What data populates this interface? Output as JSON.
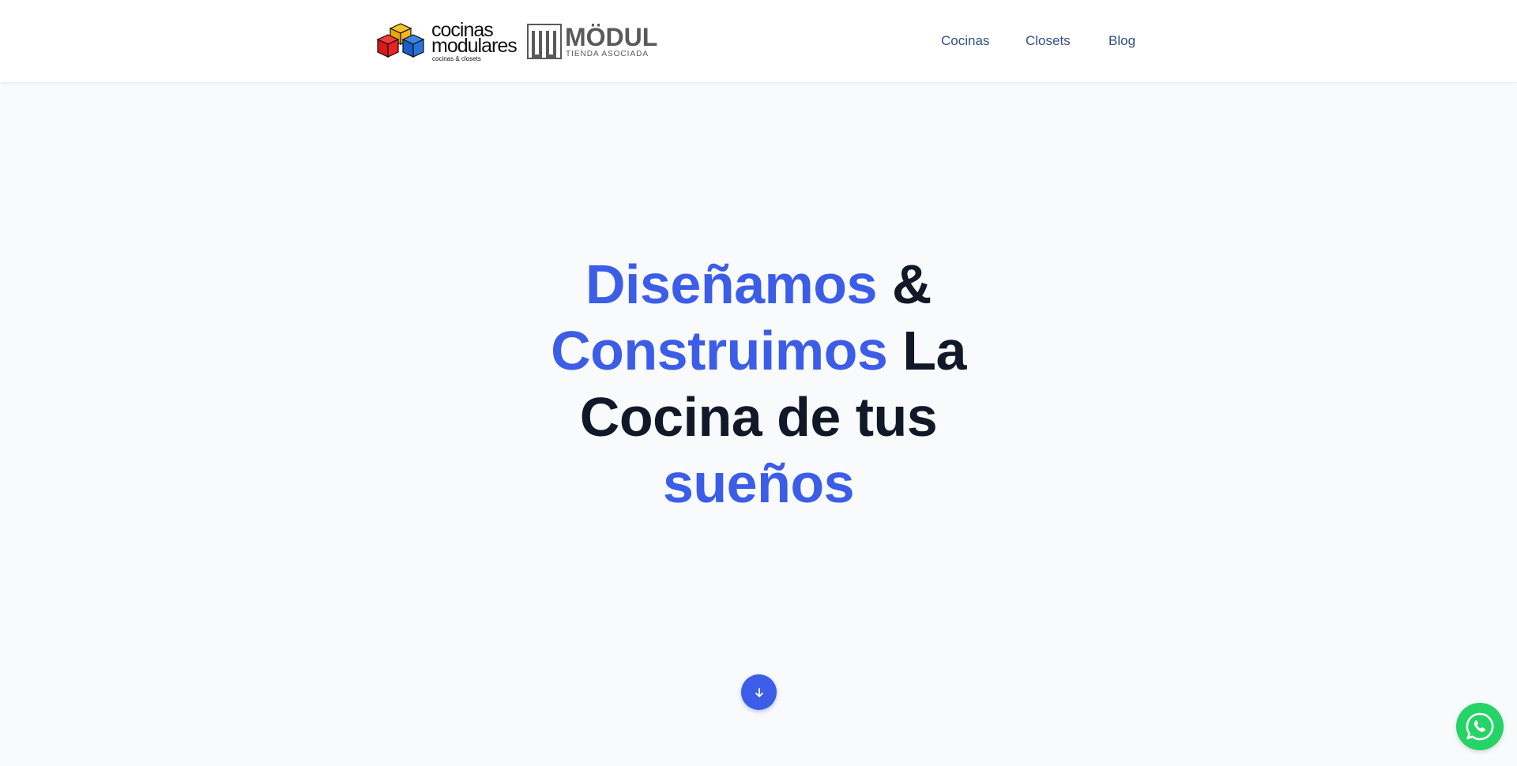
{
  "header": {
    "logo_primary": {
      "line1": "cocinas",
      "line2": "modulares",
      "tagline": "cocinas & closets"
    },
    "logo_secondary": {
      "name": "MÖDUL",
      "subtitle": "TIENDA ASOCIADA"
    },
    "nav": [
      {
        "label": "Cocinas"
      },
      {
        "label": "Closets"
      },
      {
        "label": "Blog"
      }
    ]
  },
  "hero": {
    "word1": "Diseñamos",
    "word2": " &",
    "word3": "Construimos",
    "word4": " La",
    "word5": "Cocina de tus",
    "word6": "sueños"
  },
  "buttons": {
    "scroll_icon": "arrow-down-icon",
    "whatsapp_icon": "whatsapp-icon"
  },
  "colors": {
    "accent": "#3b5de7",
    "heading": "#111827",
    "nav": "#334e8a",
    "background": "#f8fafc",
    "whatsapp": "#25d366"
  }
}
